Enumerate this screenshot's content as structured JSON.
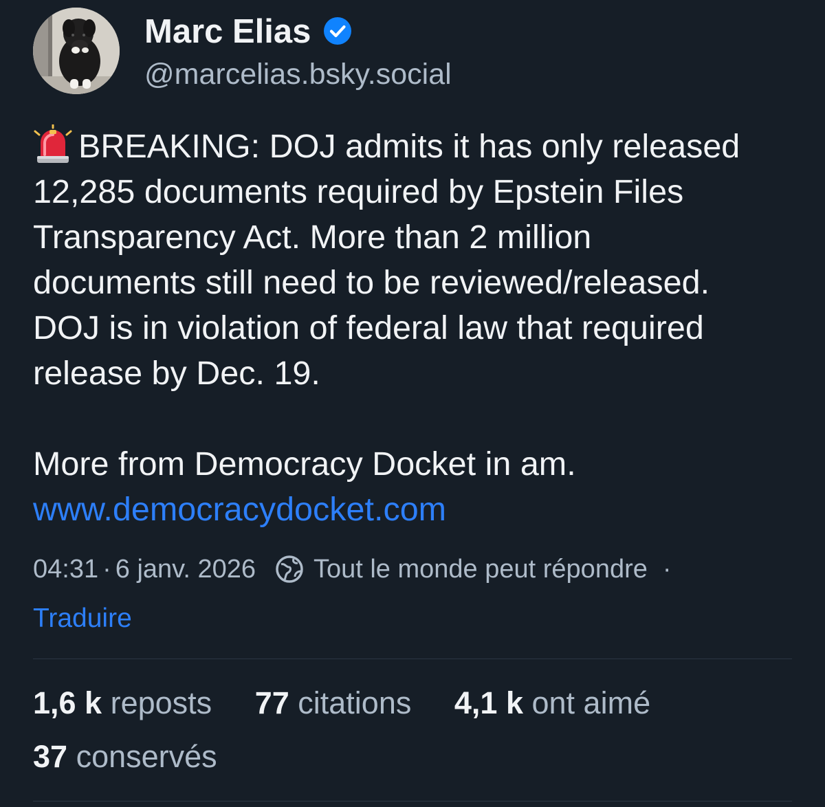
{
  "author": {
    "name": "Marc Elias",
    "handle": "@marcelias.bsky.social",
    "verified": true,
    "verified_color": "#1083fe"
  },
  "post": {
    "emoji": "siren-icon",
    "lines": [
      "BREAKING: DOJ admits it has only released",
      "12,285 documents required by Epstein Files",
      "Transparency Act. More than 2 million",
      "documents still need to be reviewed/released.",
      "DOJ is in violation of federal law that required",
      "release by Dec. 19."
    ],
    "second_paragraph": "More from Democracy Docket in am.",
    "link": "www.democracydocket.com"
  },
  "meta": {
    "time": "04:31",
    "separator": "·",
    "date": "6 janv. 2026",
    "reply_setting_icon": "globe-icon",
    "reply_setting": "Tout le monde peut répondre",
    "trailing_dot": "·",
    "translate": "Traduire"
  },
  "stats": {
    "reposts": {
      "count": "1,6 k",
      "label": "reposts"
    },
    "quotes": {
      "count": "77",
      "label": "citations"
    },
    "likes": {
      "count": "4,1 k",
      "label": "ont aimé"
    },
    "saves": {
      "count": "37",
      "label": "conservés"
    }
  },
  "colors": {
    "background": "#161e27",
    "text": "#f1f3f5",
    "muted": "#aebbc9",
    "link": "#2d7ff9",
    "divider": "#2b3644"
  }
}
